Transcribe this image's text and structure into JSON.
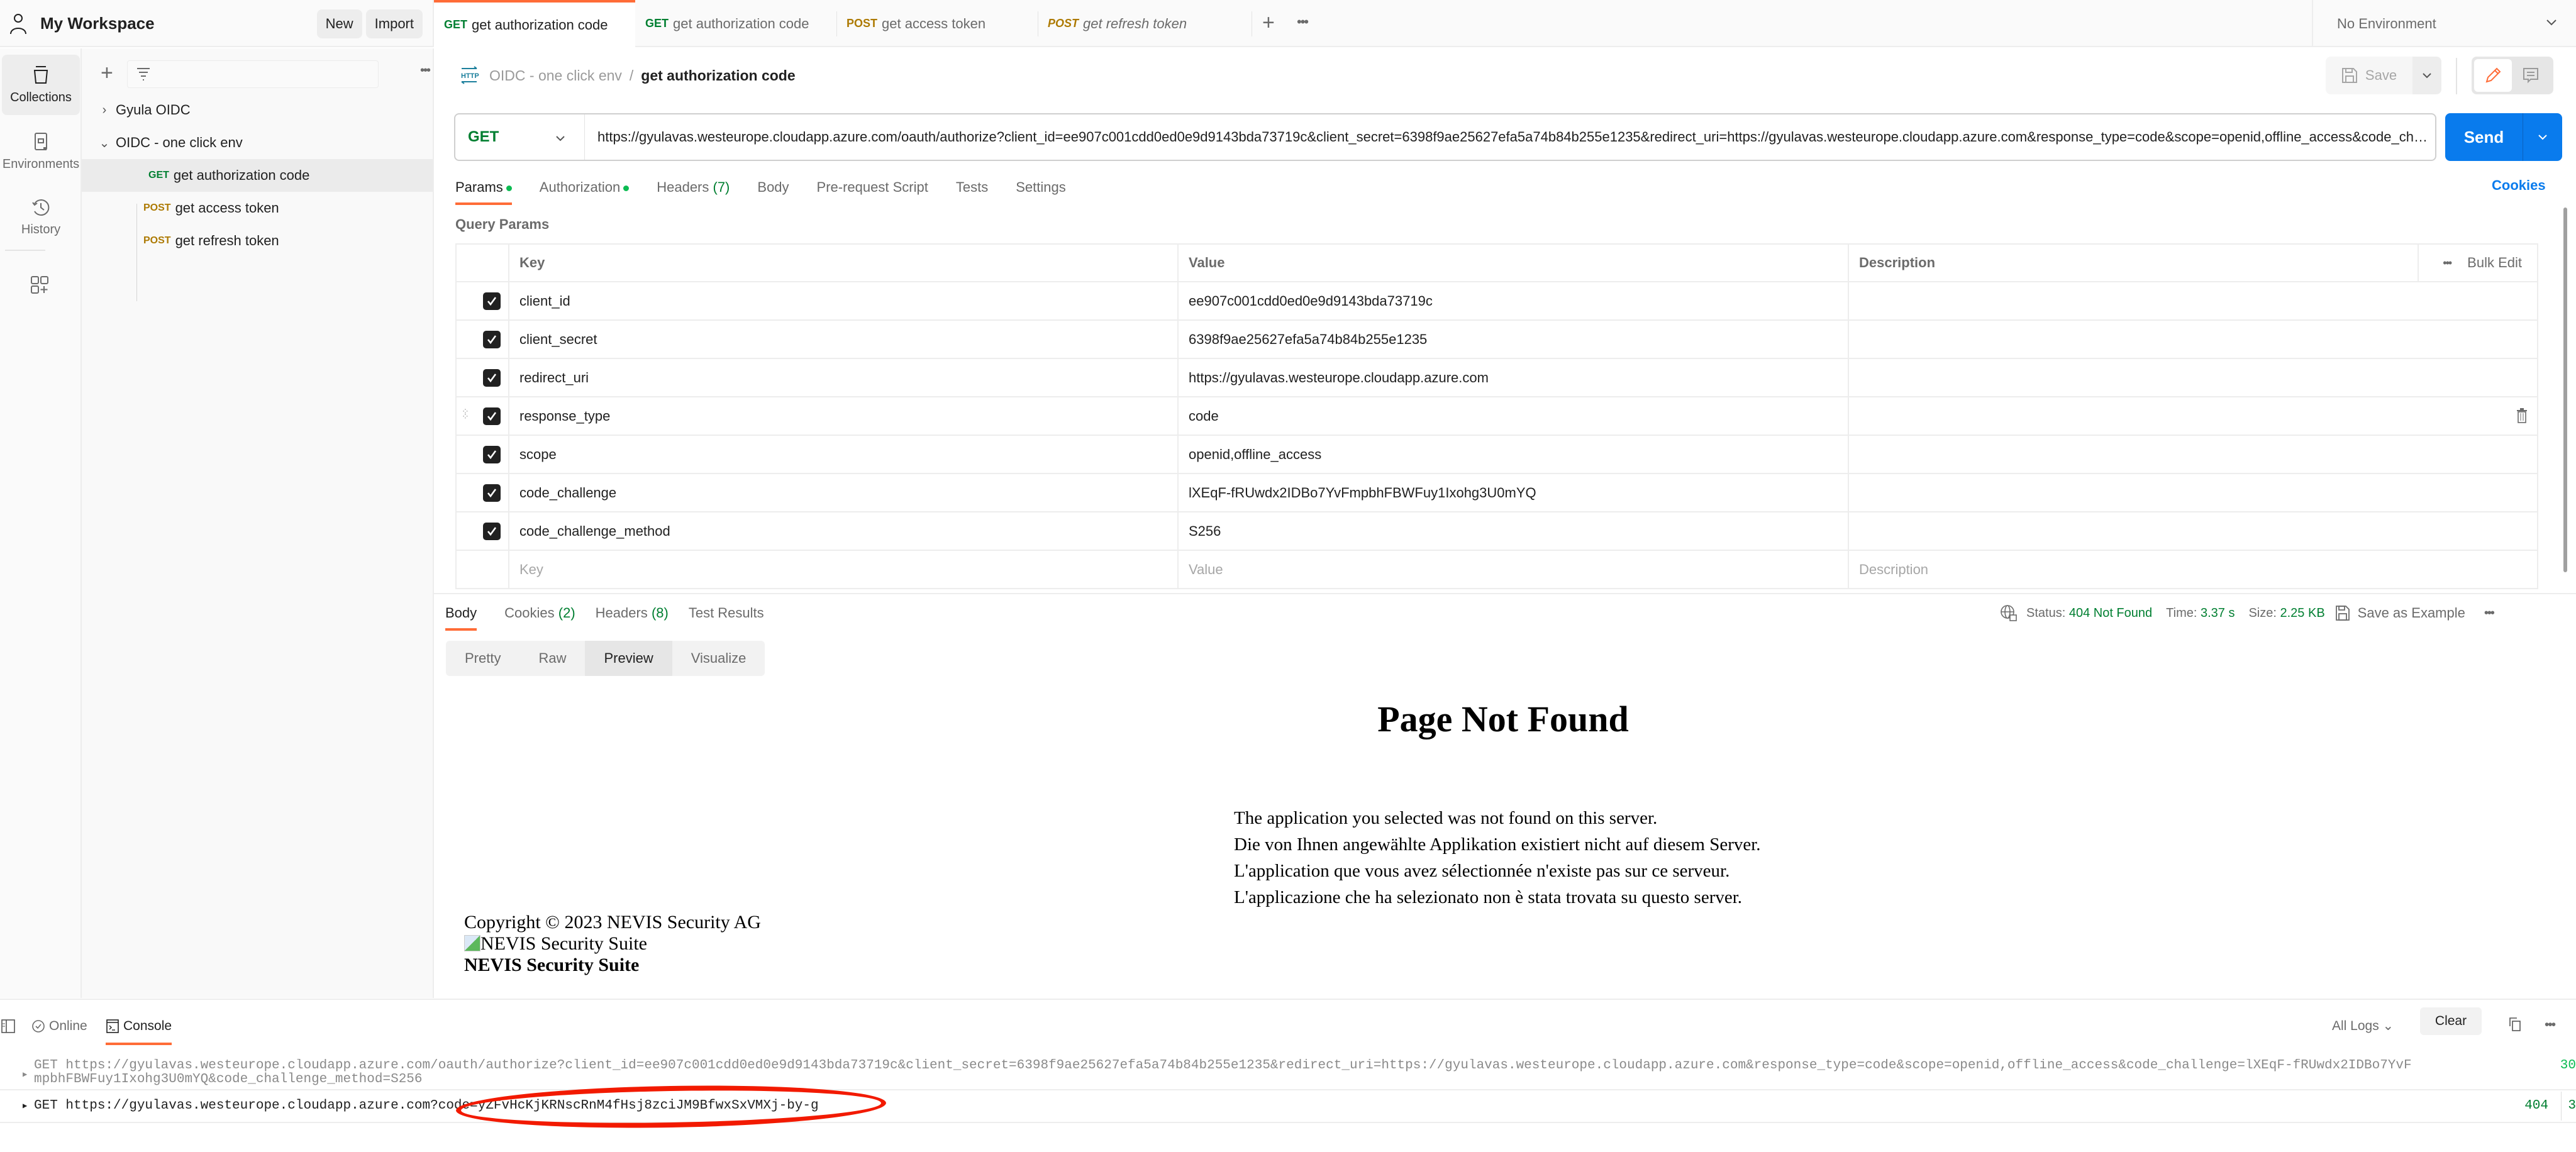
{
  "workspace": {
    "title": "My Workspace",
    "new_label": "New",
    "import_label": "Import"
  },
  "tabs": [
    {
      "method": "GET",
      "name": "get authorization code",
      "active": true
    },
    {
      "method": "GET",
      "name": "get authorization code"
    },
    {
      "method": "POST",
      "name": "get access token"
    },
    {
      "method": "POST",
      "name": "get refresh token",
      "italic": true
    }
  ],
  "tab_more": "•••",
  "environment": {
    "selected": "No Environment"
  },
  "rail": [
    {
      "label": "Collections",
      "icon": "collections-icon",
      "active": true
    },
    {
      "label": "Environments",
      "icon": "environments-icon"
    },
    {
      "label": "History",
      "icon": "history-icon"
    }
  ],
  "tree": {
    "collections": [
      {
        "name": "Gyula OIDC",
        "expanded": false
      },
      {
        "name": "OIDC - one click env",
        "expanded": true
      }
    ],
    "requests": [
      {
        "method": "GET",
        "name": "get authorization code",
        "selected": true
      },
      {
        "method": "POST",
        "name": "get access token"
      },
      {
        "method": "POST",
        "name": "get refresh token"
      }
    ],
    "more": "•••"
  },
  "breadcrumb": {
    "collection": "OIDC - one click env",
    "separator": "/",
    "request": "get authorization code"
  },
  "toolbar": {
    "save_label": "Save",
    "send_label": "Send",
    "cookies_label": "Cookies"
  },
  "request": {
    "method": "GET",
    "url": "https://gyulavas.westeurope.cloudapp.azure.com/oauth/authorize?client_id=ee907c001cdd0ed0e9d9143bda73719c&client_secret=6398f9ae25627efa5a74b84b255e1235&redirect_uri=https://gyulavas.westeurope.cloudapp.azure.com&response_type=code&scope=openid,offline_access&code_challenge=lXEqF-fRUwdx2IDBo7YvFmpbhFBWFuy1Ixohg3U0mYQ&code_challenge_method=S256"
  },
  "request_tabs": [
    {
      "label": "Params",
      "dot": true,
      "active": true
    },
    {
      "label": "Authorization",
      "dot": true
    },
    {
      "label": "Headers",
      "count": "(7)"
    },
    {
      "label": "Body"
    },
    {
      "label": "Pre-request Script"
    },
    {
      "label": "Tests"
    },
    {
      "label": "Settings"
    }
  ],
  "query_params": {
    "title": "Query Params",
    "columns": [
      "Key",
      "Value",
      "Description"
    ],
    "bulk_edit": "Bulk Edit",
    "rows": [
      {
        "key": "client_id",
        "value": "ee907c001cdd0ed0e9d9143bda73719c",
        "enabled": true
      },
      {
        "key": "client_secret",
        "value": "6398f9ae25627efa5a74b84b255e1235",
        "enabled": true
      },
      {
        "key": "redirect_uri",
        "value": "https://gyulavas.westeurope.cloudapp.azure.com",
        "enabled": true
      },
      {
        "key": "response_type",
        "value": "code",
        "enabled": true
      },
      {
        "key": "scope",
        "value": "openid,offline_access",
        "enabled": true
      },
      {
        "key": "code_challenge",
        "value": "lXEqF-fRUwdx2IDBo7YvFmpbhFBWFuy1Ixohg3U0mYQ",
        "enabled": true
      },
      {
        "key": "code_challenge_method",
        "value": "S256",
        "enabled": true
      }
    ],
    "placeholders": {
      "key": "Key",
      "value": "Value",
      "description": "Description"
    }
  },
  "response_tabs": [
    {
      "label": "Body",
      "active": true
    },
    {
      "label": "Cookies",
      "count": "(2)"
    },
    {
      "label": "Headers",
      "count": "(8)"
    },
    {
      "label": "Test Results"
    }
  ],
  "response_status": {
    "status_label": "Status:",
    "status": "404 Not Found",
    "time_label": "Time:",
    "time": "3.37 s",
    "size_label": "Size:",
    "size": "2.25 KB",
    "save_example": "Save as Example"
  },
  "view_modes": [
    {
      "label": "Pretty"
    },
    {
      "label": "Raw"
    },
    {
      "label": "Preview",
      "active": true
    },
    {
      "label": "Visualize"
    }
  ],
  "preview": {
    "heading": "Page Not Found",
    "messages": [
      "The application you selected was not found on this server.",
      "Die von Ihnen angewählte Applikation existiert nicht auf diesem Server.",
      "L'application que vous avez sélectionnée n'existe pas sur ce serveur.",
      "L'applicazione che ha selezionato non è stata trovata su questo server."
    ],
    "copyright": "Copyright © 2023 NEVIS Security AG",
    "img_alt": "NEVIS Security Suite",
    "suite": "NEVIS Security Suite"
  },
  "console": {
    "online_label": "Online",
    "console_label": "Console",
    "filter": "All Logs",
    "clear_label": "Clear",
    "logs": [
      {
        "text": "GET https://gyulavas.westeurope.cloudapp.azure.com/oauth/authorize?client_id=ee907c001cdd0ed0e9d9143bda73719c&client_secret=6398f9ae25627efa5a74b84b255e1235&redirect_uri=https://gyulavas.westeurope.cloudapp.azure.com&response_type=code&scope=openid,offline_access&code_challenge=lXEqF-fRUwdx2IDBo7YvF",
        "text_line2": "mpbhFBWFuy1Ixohg3U0mYQ&code_challenge_method=S256",
        "tail": "30"
      },
      {
        "prefix": "GET https://gyulavas.westeurope.cloudapp.azure.com",
        "highlighted": "?code=yZFvHcKjKRNscRnM4fHsj8zciJM9BfwxSxVMXj-by-g",
        "status": "404",
        "time": "3"
      }
    ]
  },
  "colors": {
    "accent": "#ff6c37",
    "send": "#097bed",
    "get": "#007f31",
    "post": "#ad7a03",
    "annotation": "#f21a00"
  }
}
